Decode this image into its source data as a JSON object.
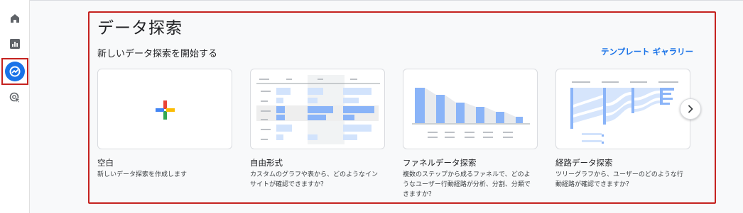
{
  "page": {
    "title": "データ探索",
    "section_title": "新しいデータ探索を開始する",
    "gallery_link": "テンプレート ギャラリー"
  },
  "nav": {
    "items": [
      {
        "name": "home",
        "icon": "home-icon"
      },
      {
        "name": "reports",
        "icon": "bar-chart-icon"
      },
      {
        "name": "explore",
        "icon": "explore-icon",
        "active": true
      },
      {
        "name": "advertising",
        "icon": "cursor-click-icon"
      }
    ],
    "active_color": "#1a73e8",
    "highlight_color": "#c5221f"
  },
  "templates": [
    {
      "title": "空白",
      "description": "新しいデータ探索を作成します",
      "icon": "plus-icon"
    },
    {
      "title": "自由形式",
      "description": "カスタムのグラフや表から、どのようなイン\nサイトが確認できますか？",
      "icon": "table-preview"
    },
    {
      "title": "ファネルデータ探索",
      "description": "複数のステップから成るファネルで、どのよ\nうなユーザー行動経路が分析、分割、分類で\nきますか？",
      "icon": "funnel-preview"
    },
    {
      "title": "経路データ探索",
      "description": "ツリーグラフから、ユーザーのどのような行\n動経路が確認できますか？",
      "icon": "path-preview"
    }
  ],
  "carousel": {
    "next_icon": "chevron-right-icon"
  },
  "colors": {
    "accent": "#1a73e8",
    "preview_blue": "#8ab4f8",
    "preview_light": "#d2e3fc"
  }
}
